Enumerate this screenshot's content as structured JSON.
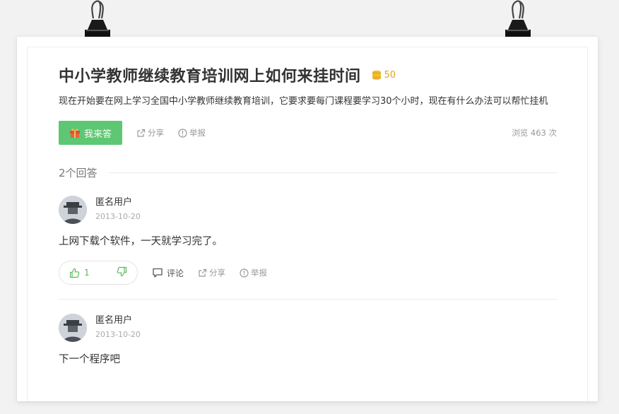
{
  "question": {
    "title": "中小学教师继续教育培训网上如何来挂时间",
    "bounty": "50",
    "description": "现在开始要在网上学习全国中小学教师继续教育培训，它要求要每门课程要学习30个小时，现在有什么办法可以帮忙挂机",
    "answer_button_label": "我来答",
    "share_label": "分享",
    "report_label": "举报",
    "views_label": "浏览 463 次"
  },
  "answers_header": "2个回答",
  "answers": [
    {
      "user_name": "匿名用户",
      "date": "2013-10-20",
      "text": "上网下载个软件，一天就学习完了。",
      "upvotes": "1",
      "comment_label": "评论",
      "share_label": "分享",
      "report_label": "举报"
    },
    {
      "user_name": "匿名用户",
      "date": "2013-10-20",
      "text": "下一个程序吧"
    }
  ],
  "colors": {
    "accent_green": "#5ec773",
    "bounty_gold": "#e1a322",
    "muted_text": "#999999"
  },
  "icons": [
    "binder-clip-icon",
    "coin-stack-icon",
    "gift-icon",
    "share-icon",
    "report-icon",
    "thumbs-up-icon",
    "thumbs-down-icon",
    "comment-icon",
    "anonymous-avatar"
  ]
}
